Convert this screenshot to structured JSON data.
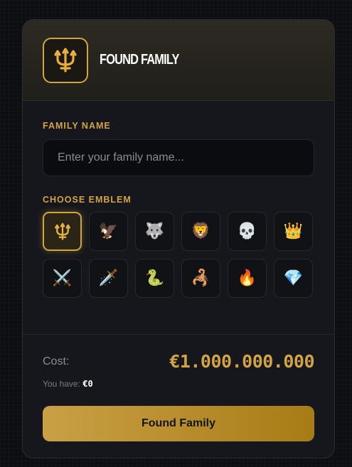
{
  "header": {
    "logo_icon": "trident-icon",
    "title": "FOUND FAMILY"
  },
  "form": {
    "family_name_label": "FAMILY NAME",
    "family_name_value": "",
    "family_name_placeholder": "Enter your family name...",
    "emblem_label": "CHOOSE EMBLEM",
    "emblems": [
      {
        "name": "trident",
        "glyph": "",
        "selected": true
      },
      {
        "name": "eagle",
        "glyph": "🦅",
        "selected": false
      },
      {
        "name": "wolf",
        "glyph": "🐺",
        "selected": false
      },
      {
        "name": "lion",
        "glyph": "🦁",
        "selected": false
      },
      {
        "name": "skull",
        "glyph": "💀",
        "selected": false
      },
      {
        "name": "crown",
        "glyph": "👑",
        "selected": false
      },
      {
        "name": "crossed-swords",
        "glyph": "⚔️",
        "selected": false
      },
      {
        "name": "dagger",
        "glyph": "🗡️",
        "selected": false
      },
      {
        "name": "snake",
        "glyph": "🐍",
        "selected": false
      },
      {
        "name": "scorpion",
        "glyph": "🦂",
        "selected": false
      },
      {
        "name": "fire",
        "glyph": "🔥",
        "selected": false
      },
      {
        "name": "gem",
        "glyph": "💎",
        "selected": false
      }
    ]
  },
  "footer": {
    "cost_label": "Cost:",
    "cost_value": "€1.000.000.000",
    "you_have_label": "You have:",
    "you_have_value": "€0",
    "submit_label": "Found Family"
  },
  "colors": {
    "accent": "#d4a53c",
    "background": "#0d0e12",
    "card": "#15171c"
  }
}
